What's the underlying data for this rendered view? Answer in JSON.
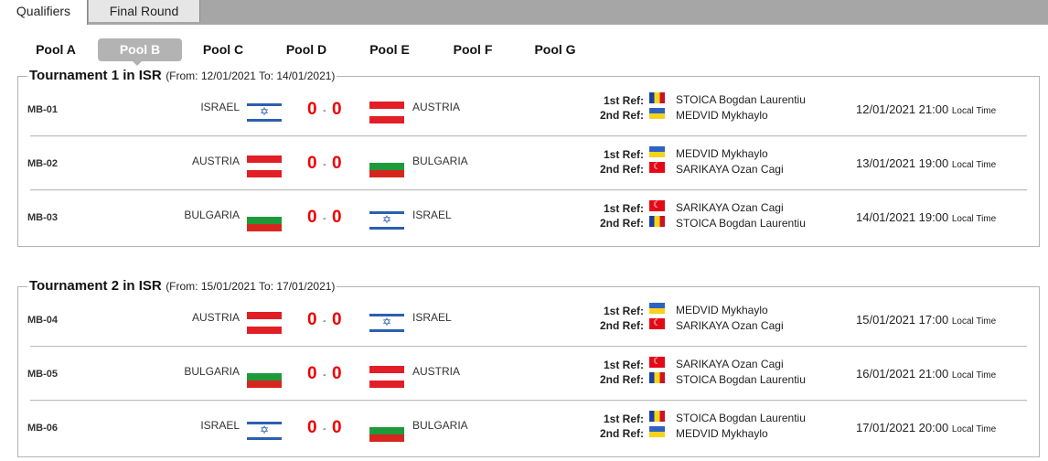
{
  "tabs": [
    {
      "label": "Qualifiers",
      "active": true
    },
    {
      "label": "Final Round",
      "active": false
    }
  ],
  "pools": [
    {
      "label": "Pool A",
      "active": false
    },
    {
      "label": "Pool B",
      "active": true
    },
    {
      "label": "Pool C",
      "active": false
    },
    {
      "label": "Pool D",
      "active": false
    },
    {
      "label": "Pool E",
      "active": false
    },
    {
      "label": "Pool F",
      "active": false
    },
    {
      "label": "Pool G",
      "active": false
    }
  ],
  "labels": {
    "first_ref": "1st Ref:",
    "second_ref": "2nd Ref:",
    "local_time": "Local Time",
    "score_sep": "-"
  },
  "tournaments": [
    {
      "title": "Tournament 1 in ISR",
      "dates": "(From: 12/01/2021  To: 14/01/2021)",
      "matches": [
        {
          "code": "MB-01",
          "home": "ISRAEL",
          "home_flag": "flag-israel-icon",
          "home_score": "0",
          "away_score": "0",
          "away": "AUSTRIA",
          "away_flag": "flag-austria-icon",
          "ref1": "STOICA Bogdan Laurentiu",
          "ref1_flag": "flag-romania-icon",
          "ref2": "MEDVID Mykhaylo",
          "ref2_flag": "flag-ukraine-icon",
          "datetime": "12/01/2021 21:00"
        },
        {
          "code": "MB-02",
          "home": "AUSTRIA",
          "home_flag": "flag-austria-icon",
          "home_score": "0",
          "away_score": "0",
          "away": "BULGARIA",
          "away_flag": "flag-bulgaria-icon",
          "ref1": "MEDVID Mykhaylo",
          "ref1_flag": "flag-ukraine-icon",
          "ref2": "SARIKAYA Ozan Cagi",
          "ref2_flag": "flag-turkey-icon",
          "datetime": "13/01/2021 19:00"
        },
        {
          "code": "MB-03",
          "home": "BULGARIA",
          "home_flag": "flag-bulgaria-icon",
          "home_score": "0",
          "away_score": "0",
          "away": "ISRAEL",
          "away_flag": "flag-israel-icon",
          "ref1": "SARIKAYA Ozan Cagi",
          "ref1_flag": "flag-turkey-icon",
          "ref2": "STOICA Bogdan Laurentiu",
          "ref2_flag": "flag-romania-icon",
          "datetime": "14/01/2021 19:00"
        }
      ]
    },
    {
      "title": "Tournament 2 in ISR",
      "dates": "(From: 15/01/2021  To: 17/01/2021)",
      "matches": [
        {
          "code": "MB-04",
          "home": "AUSTRIA",
          "home_flag": "flag-austria-icon",
          "home_score": "0",
          "away_score": "0",
          "away": "ISRAEL",
          "away_flag": "flag-israel-icon",
          "ref1": "MEDVID Mykhaylo",
          "ref1_flag": "flag-ukraine-icon",
          "ref2": "SARIKAYA Ozan Cagi",
          "ref2_flag": "flag-turkey-icon",
          "datetime": "15/01/2021 17:00"
        },
        {
          "code": "MB-05",
          "home": "BULGARIA",
          "home_flag": "flag-bulgaria-icon",
          "home_score": "0",
          "away_score": "0",
          "away": "AUSTRIA",
          "away_flag": "flag-austria-icon",
          "ref1": "SARIKAYA Ozan Cagi",
          "ref1_flag": "flag-turkey-icon",
          "ref2": "STOICA Bogdan Laurentiu",
          "ref2_flag": "flag-romania-icon",
          "datetime": "16/01/2021 21:00"
        },
        {
          "code": "MB-06",
          "home": "ISRAEL",
          "home_flag": "flag-israel-icon",
          "home_score": "0",
          "away_score": "0",
          "away": "BULGARIA",
          "away_flag": "flag-bulgaria-icon",
          "ref1": "STOICA Bogdan Laurentiu",
          "ref1_flag": "flag-romania-icon",
          "ref2": "MEDVID Mykhaylo",
          "ref2_flag": "flag-ukraine-icon",
          "datetime": "17/01/2021 20:00"
        }
      ]
    }
  ]
}
